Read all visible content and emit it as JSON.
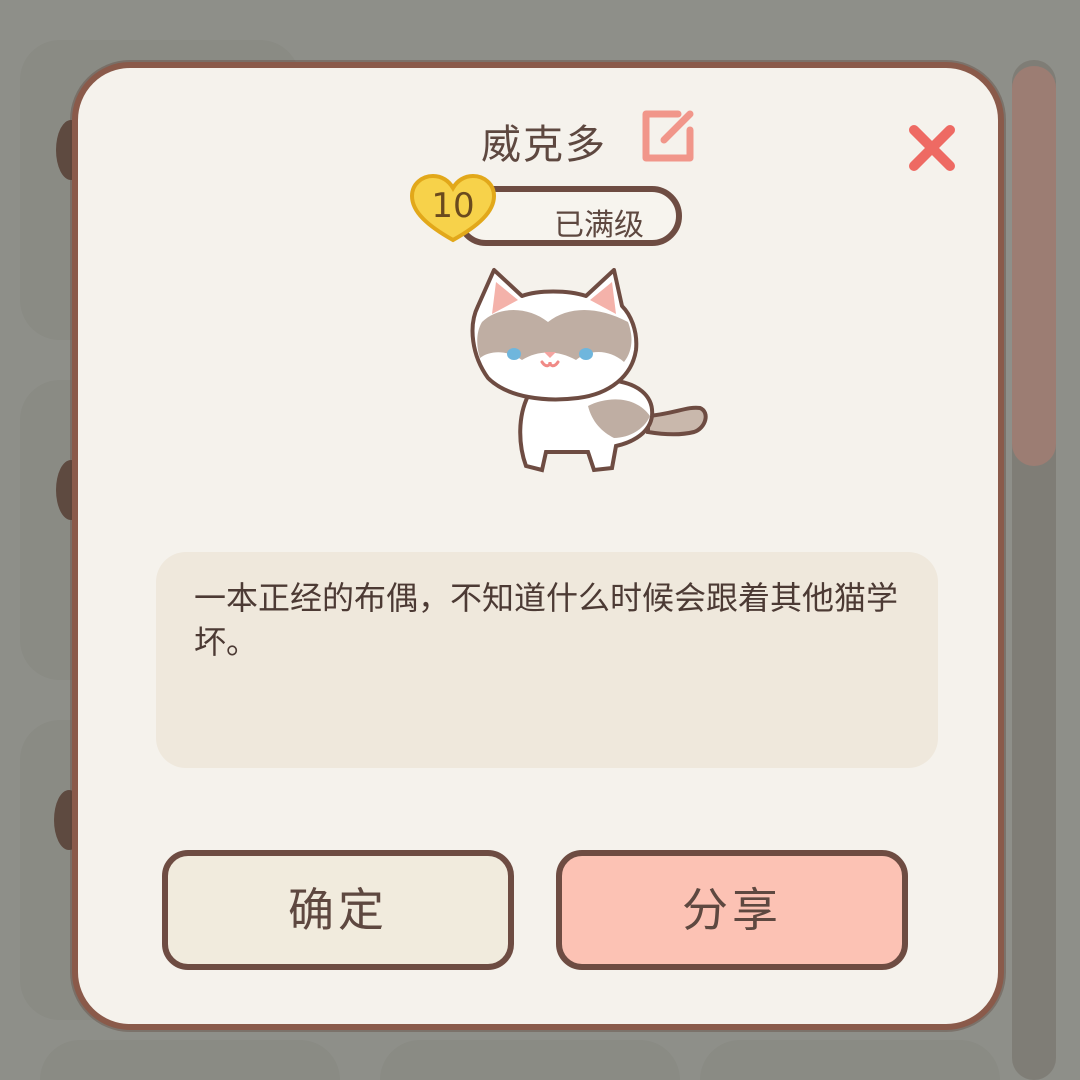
{
  "dialog": {
    "cat_name": "威克多",
    "level_number": "10",
    "level_status": "已满级",
    "description": "一本正经的布偶，不知道什么时候会跟着其他猫学坏。",
    "confirm_label": "确定",
    "share_label": "分享",
    "icons": {
      "edit": "edit-icon",
      "close": "close-icon",
      "level_badge": "heart-icon"
    }
  },
  "colors": {
    "dialog_bg": "#f5f2ec",
    "border": "#8a5a4a",
    "text": "#5e4840",
    "accent_pink": "#f1968a",
    "share_button": "#fcc2b4",
    "confirm_button": "#f1ebdd",
    "heart_yellow": "#f7d24a",
    "desc_bg": "#efe8dc"
  }
}
